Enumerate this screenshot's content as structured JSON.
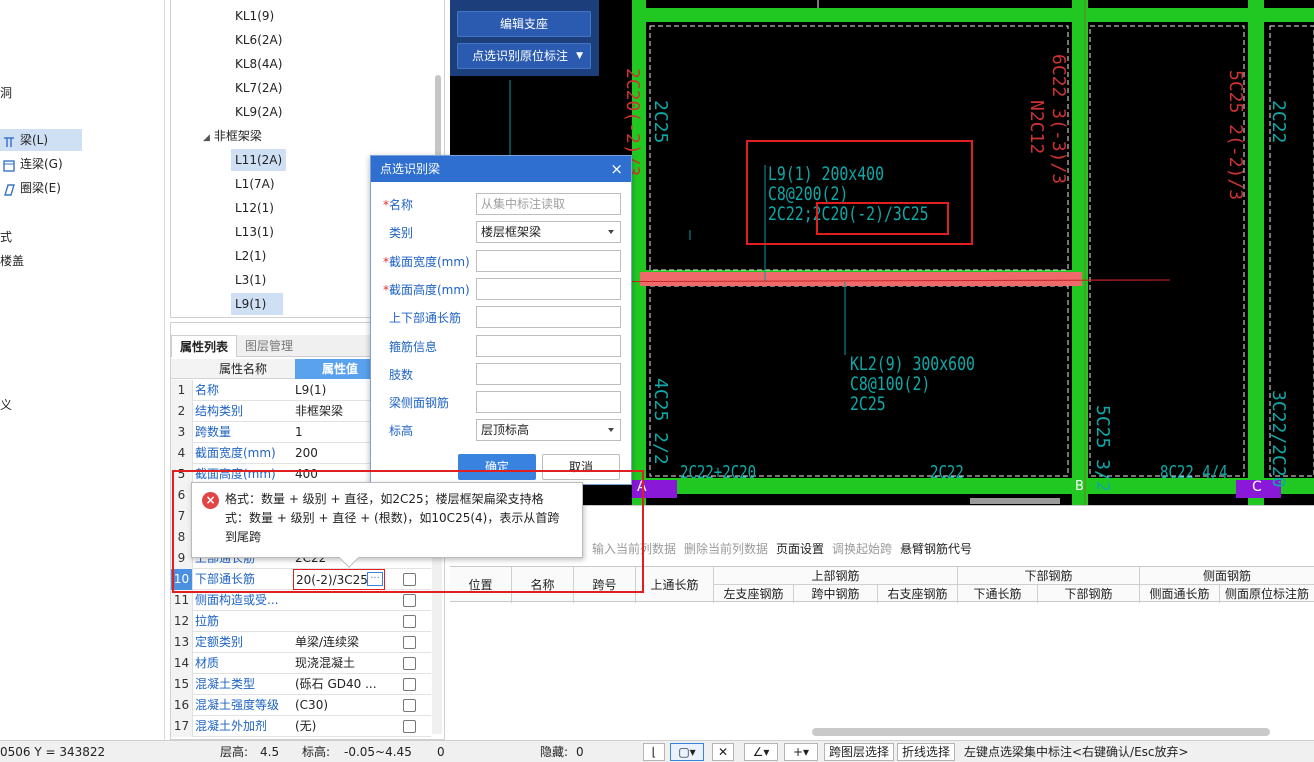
{
  "left_nav": {
    "items": [
      {
        "label": "梁(L)",
        "selected": true,
        "icon": "beam-icon"
      },
      {
        "label": "连梁(G)",
        "selected": false,
        "icon": "coupling-beam-icon"
      },
      {
        "label": "圈梁(E)",
        "selected": false,
        "icon": "ring-beam-icon"
      }
    ],
    "fragments": [
      "洞",
      "式",
      "楼盖",
      "",
      "",
      "",
      "",
      "义"
    ]
  },
  "beam_tree": {
    "frame_items": [
      "KL1(9)",
      "KL6(2A)",
      "KL8(4A)",
      "KL7(2A)",
      "KL9(2A)"
    ],
    "group_label": "非框架梁",
    "nonframe_items": [
      "L11(2A)",
      "L1(7A)",
      "L12(1)",
      "L13(1)",
      "L2(1)",
      "L3(1)",
      "L9(1)"
    ],
    "selected": "L9(1)"
  },
  "prop_panel": {
    "tabs": [
      "属性列表",
      "图层管理"
    ],
    "col_name": "属性名称",
    "col_value": "属性值",
    "rows": [
      {
        "n": "1",
        "name": "名称",
        "value": "L9(1)"
      },
      {
        "n": "2",
        "name": "结构类别",
        "value": "非框架梁"
      },
      {
        "n": "3",
        "name": "跨数量",
        "value": "1"
      },
      {
        "n": "4",
        "name": "截面宽度(mm)",
        "value": "200"
      },
      {
        "n": "5",
        "name": "截面高度(mm)",
        "value": "400"
      },
      {
        "n": "6",
        "name": "",
        "value": ""
      },
      {
        "n": "7",
        "name": "",
        "value": ""
      },
      {
        "n": "8",
        "name": "",
        "value": ""
      },
      {
        "n": "9",
        "name": "上部通长筋",
        "value": "2C22"
      },
      {
        "n": "10",
        "name": "下部通长筋",
        "value": "20(-2)/3C25"
      },
      {
        "n": "11",
        "name": "侧面构造或受...",
        "value": ""
      },
      {
        "n": "12",
        "name": "拉筋",
        "value": ""
      },
      {
        "n": "13",
        "name": "定额类别",
        "value": "单梁/连续梁"
      },
      {
        "n": "14",
        "name": "材质",
        "value": "现浇混凝土"
      },
      {
        "n": "15",
        "name": "混凝土类型",
        "value": "(砾石 GD40 ..."
      },
      {
        "n": "16",
        "name": "混凝土强度等级",
        "value": "(C30)"
      },
      {
        "n": "17",
        "name": "混凝土外加剂",
        "value": "(无)"
      }
    ],
    "edit_btn": "···"
  },
  "cad_buttons": {
    "edit_support": "编辑支座",
    "pick_recognize": "点选识别原位标注"
  },
  "dialog": {
    "title": "点选识别梁",
    "close": "×",
    "fields": [
      {
        "label": "名称",
        "required": true,
        "value": "",
        "placeholder": "从集中标注读取",
        "dropdown": false
      },
      {
        "label": "类别",
        "required": false,
        "value": "楼层框架梁",
        "placeholder": "",
        "dropdown": true
      },
      {
        "label": "截面宽度(mm)",
        "required": true,
        "value": "",
        "placeholder": "",
        "dropdown": false
      },
      {
        "label": "截面高度(mm)",
        "required": true,
        "value": "",
        "placeholder": "",
        "dropdown": false
      },
      {
        "label": "上下部通长筋",
        "required": false,
        "value": "",
        "placeholder": "",
        "dropdown": false
      },
      {
        "label": "箍筋信息",
        "required": false,
        "value": "",
        "placeholder": "",
        "dropdown": false
      },
      {
        "label": "肢数",
        "required": false,
        "value": "",
        "placeholder": "",
        "dropdown": false
      },
      {
        "label": "梁侧面钢筋",
        "required": false,
        "value": "",
        "placeholder": "",
        "dropdown": false
      },
      {
        "label": "标高",
        "required": false,
        "value": "层顶标高",
        "placeholder": "",
        "dropdown": true
      }
    ],
    "ok": "确定",
    "cancel": "取消"
  },
  "tooltip": {
    "icon": "error-icon",
    "text": "格式：数量 + 级别 + 直径，如2C25；楼层框架扁梁支持格式：数量 + 级别 + 直径 + (根数)，如10C25(4)，表示从首跨到尾跨"
  },
  "cad_text": {
    "beam_label": [
      "L9(1) 200x400",
      "C8@200(2)",
      "2C22;2C20(-2)/3C25"
    ],
    "kl2_label": [
      "KL2(9) 300x600",
      "C8@100(2)",
      "2C25"
    ],
    "vertical_left": [
      "2C20(-2)/3",
      "2C25"
    ],
    "vertical_mid": [
      "6C22 3(-3)/3",
      "N2C12"
    ],
    "vertical_right": [
      "5C25 2(-2)/3",
      "2C22"
    ],
    "vertical_bottom_left": "4C25 2/2",
    "vertical_bottom_mid": "5C25 3/2",
    "vertical_bottom_right": "3C22/2C20",
    "bottom_row": [
      "2C22+2C20",
      "2C22",
      "8C22 4/4"
    ],
    "axes": [
      "A",
      "B",
      "C"
    ]
  },
  "lower_panel": {
    "toolbar": [
      {
        "label": "输入当前列数据",
        "disabled": true
      },
      {
        "label": "删除当前列数据",
        "disabled": true
      },
      {
        "label": "页面设置",
        "disabled": false
      },
      {
        "label": "调换起始跨",
        "disabled": true
      },
      {
        "label": "悬臂钢筋代号",
        "disabled": false
      }
    ],
    "headers": {
      "position": "位置",
      "name": "名称",
      "span": "跨号",
      "top_through": "上通长筋",
      "top_group": "上部钢筋",
      "top_left": "左支座钢筋",
      "top_mid": "跨中钢筋",
      "top_right": "右支座钢筋",
      "bottom_group": "下部钢筋",
      "bottom_through": "下通长筋",
      "bottom_bars": "下部钢筋",
      "side_group": "侧面钢筋",
      "side_through": "侧面通长筋",
      "side_inplace": "侧面原位标注筋"
    }
  },
  "status_bar": {
    "coord": "0506 Y = 343822",
    "floor_height_label": "层高:",
    "floor_height": "4.5",
    "elevation_label": "标高:",
    "elevation": "-0.05~4.45",
    "zero": "0",
    "hidden_label": "隐藏:",
    "hidden": "0",
    "cross_layer": "跨图层选择",
    "polyline": "折线选择",
    "hint": "左键点选梁集中标注<右键确认/Esc放弃>"
  }
}
